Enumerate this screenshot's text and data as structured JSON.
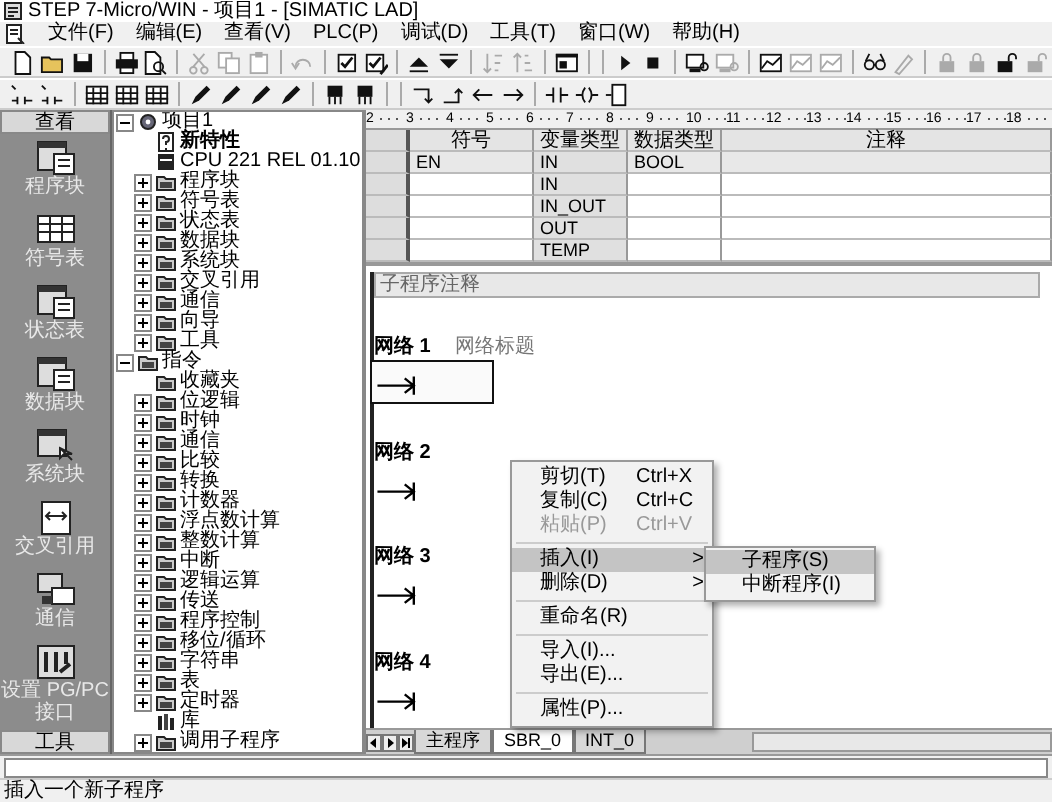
{
  "window": {
    "title": "STEP 7-Micro/WIN - 项目1 - [SIMATIC LAD]"
  },
  "menu_bar": [
    "文件(F)",
    "编辑(E)",
    "查看(V)",
    "PLC(P)",
    "调试(D)",
    "工具(T)",
    "窗口(W)",
    "帮助(H)"
  ],
  "toolbar_1": [
    {
      "kind": "page",
      "disabled": false
    },
    {
      "kind": "folder",
      "disabled": false
    },
    {
      "kind": "disk",
      "disabled": false
    },
    {
      "kind": "separator"
    },
    {
      "kind": "printer",
      "disabled": false
    },
    {
      "kind": "page-magnifier",
      "disabled": false
    },
    {
      "kind": "separator"
    },
    {
      "kind": "scissors",
      "disabled": true
    },
    {
      "kind": "pages",
      "disabled": true
    },
    {
      "kind": "clipboard",
      "disabled": true
    },
    {
      "kind": "separator"
    },
    {
      "kind": "undo-arrow",
      "disabled": true
    },
    {
      "kind": "separator"
    },
    {
      "kind": "checkbox",
      "disabled": false
    },
    {
      "kind": "checkbox-pen",
      "disabled": false
    },
    {
      "kind": "separator"
    },
    {
      "kind": "up-triangle",
      "disabled": false
    },
    {
      "kind": "down-triangle",
      "disabled": false
    },
    {
      "kind": "separator"
    },
    {
      "kind": "sort-down",
      "disabled": true
    },
    {
      "kind": "sort-up",
      "disabled": true
    },
    {
      "kind": "separator"
    },
    {
      "kind": "window",
      "disabled": false
    },
    {
      "kind": "separator"
    },
    {
      "kind": "separator"
    },
    {
      "kind": "play",
      "disabled": false
    },
    {
      "kind": "stop",
      "disabled": false
    },
    {
      "kind": "separator"
    },
    {
      "kind": "monitor",
      "disabled": false
    },
    {
      "kind": "monitor",
      "disabled": true
    },
    {
      "kind": "separator"
    },
    {
      "kind": "chart-window",
      "disabled": false
    },
    {
      "kind": "chart-window",
      "disabled": true
    },
    {
      "kind": "chart-window",
      "disabled": true
    },
    {
      "kind": "separator"
    },
    {
      "kind": "glasses",
      "disabled": false
    },
    {
      "kind": "pen",
      "disabled": true
    },
    {
      "kind": "separator"
    },
    {
      "kind": "lock",
      "disabled": true
    },
    {
      "kind": "lock",
      "disabled": true
    },
    {
      "kind": "unlock",
      "disabled": false
    },
    {
      "kind": "unlock",
      "disabled": true
    }
  ],
  "toolbar_2": [
    {
      "kind": "contact-arrow",
      "disabled": false
    },
    {
      "kind": "contact-arrow",
      "disabled": false
    },
    {
      "kind": "separator"
    },
    {
      "kind": "grid",
      "disabled": false
    },
    {
      "kind": "grid",
      "disabled": false
    },
    {
      "kind": "grid",
      "disabled": false
    },
    {
      "kind": "separator"
    },
    {
      "kind": "pencil",
      "disabled": false
    },
    {
      "kind": "pencil",
      "disabled": false
    },
    {
      "kind": "pencil",
      "disabled": false
    },
    {
      "kind": "pencil",
      "disabled": false
    },
    {
      "kind": "separator"
    },
    {
      "kind": "component",
      "disabled": false
    },
    {
      "kind": "component",
      "disabled": false
    },
    {
      "kind": "separator"
    },
    {
      "kind": "separator"
    },
    {
      "kind": "line-down-right",
      "disabled": false
    },
    {
      "kind": "line-up-right",
      "disabled": false
    },
    {
      "kind": "arrow-left",
      "disabled": false
    },
    {
      "kind": "arrow-right",
      "disabled": false
    },
    {
      "kind": "separator"
    },
    {
      "kind": "contact",
      "disabled": false
    },
    {
      "kind": "coil",
      "disabled": false
    },
    {
      "kind": "box",
      "disabled": false
    }
  ],
  "navigation_bar": {
    "header": "查看",
    "items": [
      {
        "label": "程序块",
        "kind": "block"
      },
      {
        "label": "符号表",
        "kind": "table"
      },
      {
        "label": "状态表",
        "kind": "block"
      },
      {
        "label": "数据块",
        "kind": "block"
      },
      {
        "label": "系统块",
        "kind": "system"
      },
      {
        "label": "交叉引用",
        "kind": "cross"
      },
      {
        "label": "通信",
        "kind": "comm"
      },
      {
        "label": "设置 PG/PC 接口",
        "kind": "interface"
      }
    ],
    "footer": "工具"
  },
  "project_tree": [
    {
      "label": "项目1",
      "kind": "project",
      "expanded": true,
      "children": [
        {
          "label": "新特性",
          "kind": "info"
        },
        {
          "label": "CPU 221 REL 01.10",
          "kind": "cpu"
        },
        {
          "label": "程序块",
          "kind": "folder",
          "expanded": false
        },
        {
          "label": "符号表",
          "kind": "folder",
          "expanded": false
        },
        {
          "label": "状态表",
          "kind": "folder",
          "expanded": false
        },
        {
          "label": "数据块",
          "kind": "folder",
          "expanded": false
        },
        {
          "label": "系统块",
          "kind": "folder",
          "expanded": false
        },
        {
          "label": "交叉引用",
          "kind": "folder",
          "expanded": false
        },
        {
          "label": "通信",
          "kind": "folder",
          "expanded": false
        },
        {
          "label": "向导",
          "kind": "folder",
          "expanded": false
        },
        {
          "label": "工具",
          "kind": "folder",
          "expanded": false
        }
      ]
    },
    {
      "label": "指令",
      "kind": "folder",
      "expanded": true,
      "children": [
        {
          "label": "收藏夹",
          "kind": "folder"
        },
        {
          "label": "位逻辑",
          "kind": "folder",
          "expanded": false
        },
        {
          "label": "时钟",
          "kind": "folder",
          "expanded": false
        },
        {
          "label": "通信",
          "kind": "folder",
          "expanded": false
        },
        {
          "label": "比较",
          "kind": "folder",
          "expanded": false
        },
        {
          "label": "转换",
          "kind": "folder",
          "expanded": false
        },
        {
          "label": "计数器",
          "kind": "folder",
          "expanded": false
        },
        {
          "label": "浮点数计算",
          "kind": "folder",
          "expanded": false
        },
        {
          "label": "整数计算",
          "kind": "folder",
          "expanded": false
        },
        {
          "label": "中断",
          "kind": "folder",
          "expanded": false
        },
        {
          "label": "逻辑运算",
          "kind": "folder",
          "expanded": false
        },
        {
          "label": "传送",
          "kind": "folder",
          "expanded": false
        },
        {
          "label": "程序控制",
          "kind": "folder",
          "expanded": false
        },
        {
          "label": "移位/循环",
          "kind": "folder",
          "expanded": false
        },
        {
          "label": "字符串",
          "kind": "folder",
          "expanded": false
        },
        {
          "label": "表",
          "kind": "folder",
          "expanded": false
        },
        {
          "label": "定时器",
          "kind": "folder",
          "expanded": false
        },
        {
          "label": "库",
          "kind": "library"
        },
        {
          "label": "调用子程序",
          "kind": "folder",
          "expanded": false
        }
      ]
    }
  ],
  "editor": {
    "ruler": [
      "2",
      "3",
      "4",
      "5",
      "6",
      "7",
      "8",
      "9",
      "10",
      "11",
      "12",
      "13",
      "14",
      "15",
      "16",
      "17",
      "18"
    ],
    "variable_table": {
      "columns": [
        "符号",
        "变量类型",
        "数据类型",
        "注释"
      ],
      "rows": [
        {
          "symbol": "EN",
          "var_type": "IN",
          "data_type": "BOOL",
          "locked": true
        },
        {
          "var_type": "IN",
          "locked": false
        },
        {
          "var_type": "IN_OUT",
          "locked": false
        },
        {
          "var_type": "OUT",
          "locked": false
        },
        {
          "var_type": "TEMP",
          "locked": false
        }
      ]
    },
    "subroutine_comment": "子程序注释",
    "networks": [
      {
        "label": "网络 1",
        "title": "网络标题",
        "selected": true
      },
      {
        "label": "网络 2",
        "selected": false
      },
      {
        "label": "网络 3",
        "selected": false
      },
      {
        "label": "网络 4",
        "selected": false
      }
    ],
    "tabs": [
      {
        "label": "主程序",
        "selected": false
      },
      {
        "label": "SBR_0",
        "selected": true
      },
      {
        "label": "INT_0",
        "selected": false
      }
    ]
  },
  "context_menu": [
    {
      "kind": "item",
      "label": "剪切(T)",
      "shortcut": "Ctrl+X",
      "disabled": false,
      "selected": false
    },
    {
      "kind": "item",
      "label": "复制(C)",
      "shortcut": "Ctrl+C",
      "disabled": false,
      "selected": false
    },
    {
      "kind": "item",
      "label": "粘贴(P)",
      "shortcut": "Ctrl+V",
      "disabled": true,
      "selected": false
    },
    {
      "kind": "separator"
    },
    {
      "kind": "item",
      "label": "插入(I)",
      "arrow": ">",
      "disabled": false,
      "selected": true
    },
    {
      "kind": "item",
      "label": "删除(D)",
      "arrow": ">",
      "disabled": false,
      "selected": false
    },
    {
      "kind": "separator"
    },
    {
      "kind": "item",
      "label": "重命名(R)",
      "disabled": false,
      "selected": false
    },
    {
      "kind": "separator"
    },
    {
      "kind": "item",
      "label": "导入(I)...",
      "disabled": false,
      "selected": false
    },
    {
      "kind": "item",
      "label": "导出(E)...",
      "disabled": false,
      "selected": false
    },
    {
      "kind": "separator"
    },
    {
      "kind": "item",
      "label": "属性(P)...",
      "disabled": false,
      "selected": false
    }
  ],
  "submenu": [
    {
      "label": "子程序(S)",
      "selected": true
    },
    {
      "label": "中断程序(I)",
      "selected": false
    }
  ],
  "status_bar": "插入一个新子程序"
}
